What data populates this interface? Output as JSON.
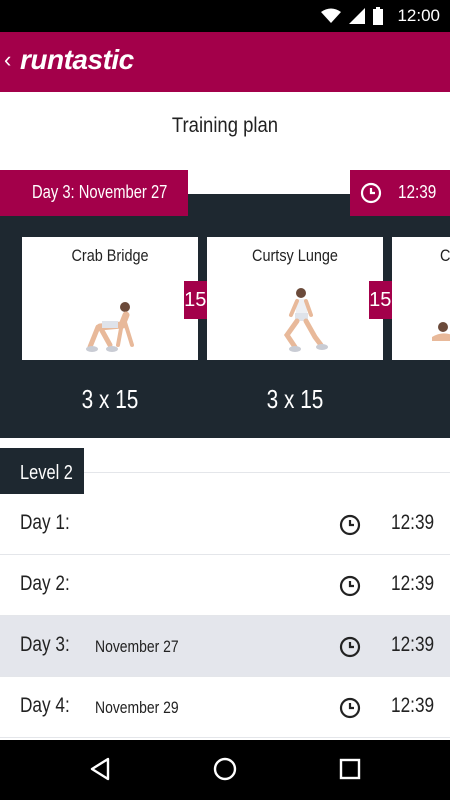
{
  "status_bar": {
    "time": "12:00"
  },
  "app_bar": {
    "logo_text": "runtastic",
    "back_glyph": "‹"
  },
  "page": {
    "title": "Training plan"
  },
  "current_day": {
    "label": "Day 3: November 27",
    "duration": "12:39"
  },
  "exercises": [
    {
      "name": "Crab Bridge",
      "duration": "15 s",
      "reps": "3 x 15"
    },
    {
      "name": "Curtsy Lunge",
      "duration": "15 s",
      "reps": "3 x 15"
    },
    {
      "name": "Cl"
    }
  ],
  "level": {
    "label": "Level 2"
  },
  "days": [
    {
      "label": "Day 1:",
      "date": "",
      "duration": "12:39"
    },
    {
      "label": "Day 2:",
      "date": "",
      "duration": "12:39"
    },
    {
      "label": "Day 3:",
      "date": "November 27",
      "duration": "12:39"
    },
    {
      "label": "Day 4:",
      "date": "November 29",
      "duration": "12:39"
    }
  ],
  "icons": {
    "wifi": "wifi-icon",
    "signal": "signal-icon",
    "battery": "battery-icon",
    "clock": "clock-icon",
    "back": "nav-back-icon",
    "home": "nav-home-icon",
    "recents": "nav-recents-icon"
  },
  "colors": {
    "brand": "#a3004a",
    "panel": "#1e2830",
    "active_row": "#e4e6ec"
  }
}
